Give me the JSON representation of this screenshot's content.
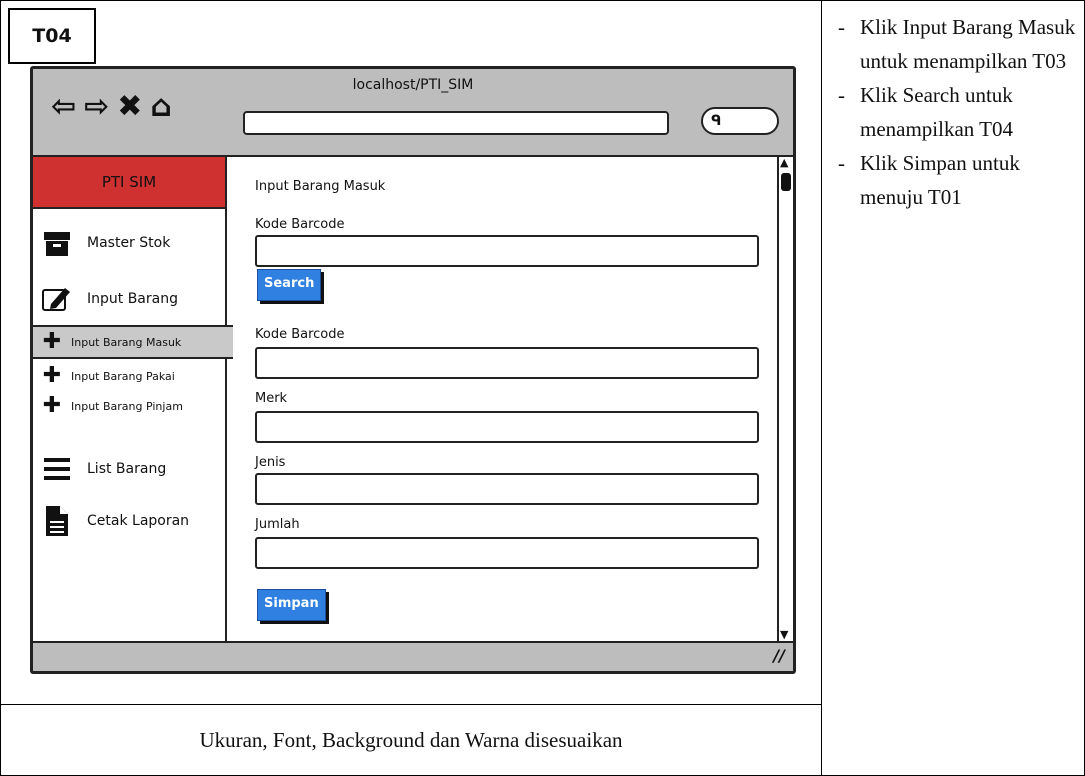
{
  "tag": "T04",
  "browser": {
    "url": "localhost/PTI_SIM",
    "nav_icons": [
      "back-arrow-icon",
      "forward-arrow-icon",
      "stop-icon",
      "home-icon"
    ],
    "search_icon_glyph": "ᑫ"
  },
  "sidebar": {
    "brand": "PTI SIM",
    "items": [
      {
        "label": "Master Stok",
        "icon": "archive-icon"
      },
      {
        "label": "Input Barang",
        "icon": "edit-icon"
      },
      {
        "label": "Input Barang Masuk",
        "icon": "plus-icon",
        "active": true
      },
      {
        "label": "Input Barang Pakai",
        "icon": "plus-icon"
      },
      {
        "label": "Input Barang Pinjam",
        "icon": "plus-icon"
      },
      {
        "label": "List Barang",
        "icon": "menu-icon"
      },
      {
        "label": "Cetak Laporan",
        "icon": "document-icon"
      }
    ]
  },
  "form": {
    "heading": "Input Barang Masuk",
    "search_label": "Kode Barcode",
    "search_button": "Search",
    "fields": [
      "Kode Barcode",
      "Merk",
      "Jenis",
      "Jumlah"
    ],
    "save_button": "Simpan"
  },
  "notes": [
    "Klik Input Barang Masuk untuk menampilkan T03",
    "Klik Search untuk menampilkan T04",
    "Klik Simpan untuk menuju T01"
  ],
  "footer": "Ukuran, Font, Background dan Warna disesuaikan"
}
